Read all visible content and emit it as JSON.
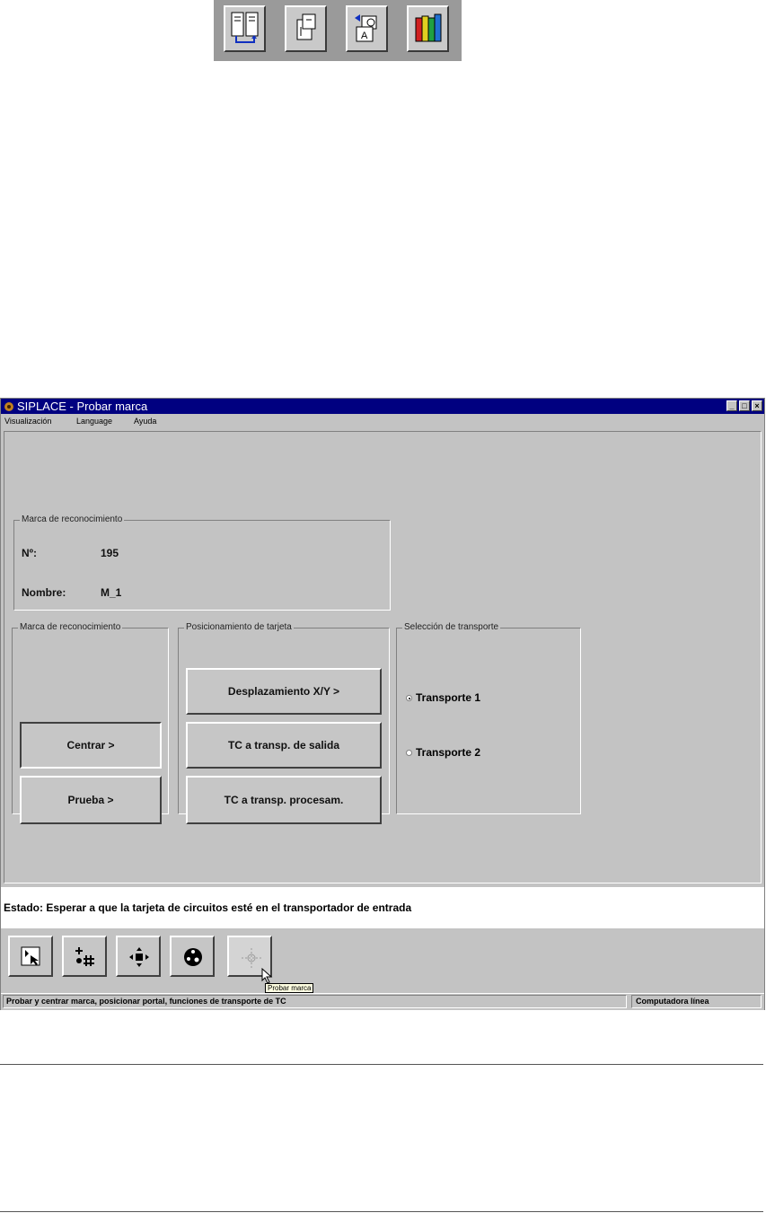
{
  "top_toolbar": {
    "icons": [
      "book-layout-icon",
      "document-page-icon",
      "search-page-icon",
      "books-icon"
    ]
  },
  "window": {
    "title": "SIPLACE - Probar marca",
    "controls": [
      "_",
      "□",
      "×"
    ],
    "menu": [
      "Visualización",
      "Language",
      "Ayuda"
    ]
  },
  "mark_info": {
    "group_title": "Marca de reconocimiento",
    "number_label": "Nº:",
    "number_value": "195",
    "name_label": "Nombre:",
    "name_value": "M_1"
  },
  "mark_group": {
    "title": "Marca de reconocimiento",
    "center_button": "Centrar >",
    "test_button": "Prueba >"
  },
  "positioning_group": {
    "title": "Posicionamiento de tarjeta",
    "xy_button": "Desplazamiento X/Y >",
    "exit_button": "TC a transp. de salida",
    "process_button": "TC a transp. procesam."
  },
  "transport_group": {
    "title": "Selección de transporte",
    "options": [
      {
        "label": "Transporte 1",
        "selected": true
      },
      {
        "label": "Transporte 2",
        "selected": false
      }
    ]
  },
  "status": {
    "text": "Estado: Esperar a que la tarjeta de circuitos esté en el transportador de entrada"
  },
  "bottom_tools": {
    "icons": [
      "select-arrow-icon",
      "grid-add-icon",
      "move-cross-icon",
      "circle-dots-icon",
      "crosshair-icon"
    ],
    "tooltip": "Probar marca"
  },
  "statusbar": {
    "left": "Probar y centrar marca, posicionar portal, funciones de transporte de TC",
    "right": "Computadora línea"
  }
}
